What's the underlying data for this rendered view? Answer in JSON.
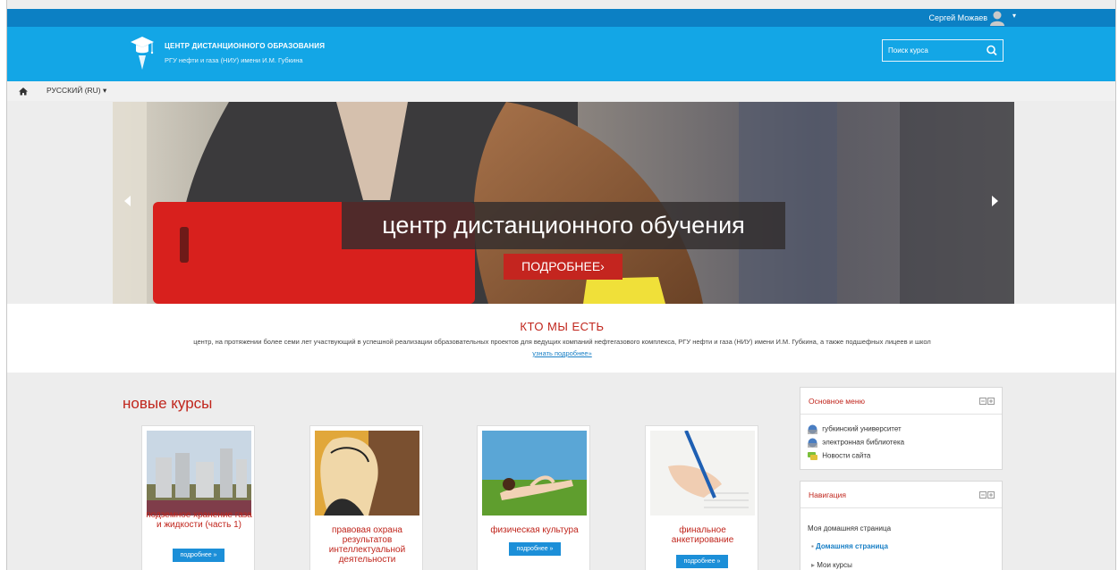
{
  "topbar": {
    "user_name": "Сергей Можаев",
    "caret": "▾"
  },
  "header": {
    "title": "ЦЕНТР ДИСТАНЦИОННОГО ОБРАЗОВАНИЯ",
    "subtitle": "РГУ нефти и газа (НИУ) имени И.М. Губкина",
    "search_placeholder": "Поиск курса"
  },
  "langbar": {
    "language": "РУССКИЙ (RU) ▾"
  },
  "hero": {
    "caption": "центр дистанционного обучения",
    "button": "ПОДРОБНЕЕ›"
  },
  "about": {
    "title": "КТО МЫ ЕСТЬ",
    "text": "центр, на протяжении более семи лет участвующий в успешной реализации образовательных проектов для ведущих компаний нефтегазового комплекса, РГУ нефти и газа (НИУ) имени И.М. Губкина, а также подшефных лицеев и школ",
    "link": "узнать подробнее»"
  },
  "courses": {
    "title": "новые курсы",
    "items": [
      {
        "title": "подземное хранение газа и жидкости (часть 1)",
        "more": "подробнее »"
      },
      {
        "title": "правовая охрана результатов интеллектуальной деятельности",
        "more": "подробнее »"
      },
      {
        "title": "физическая культура",
        "more": "подробнее »"
      },
      {
        "title": "финальное анкетирование",
        "more": "подробнее »"
      }
    ]
  },
  "main_menu": {
    "title": "Основное меню",
    "items": [
      "губкинский университет",
      "электронная библиотека",
      "Новости сайта"
    ]
  },
  "navigation": {
    "title": "Навигация",
    "home": "Моя домашняя страница",
    "items": [
      "Домашняя страница",
      "Мои курсы"
    ]
  },
  "colors": {
    "topbar": "#0c80c4",
    "header": "#13a6e6",
    "accent_red": "#c0251c",
    "button_blue": "#1c8fd8"
  }
}
